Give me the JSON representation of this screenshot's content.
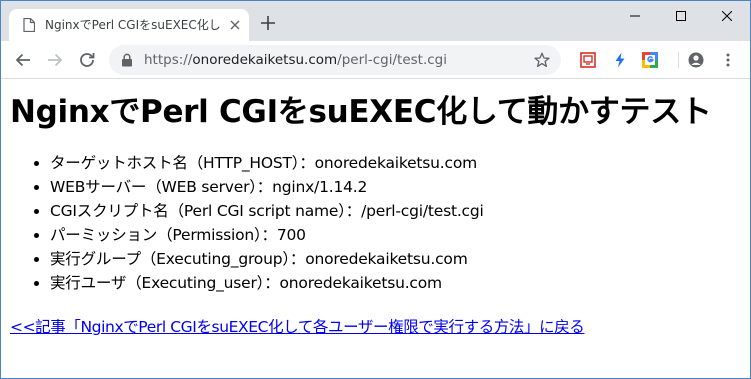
{
  "browser": {
    "tab_title": "NginxでPerl CGIをsuEXEC化して動かすテスト",
    "url_scheme": "https://",
    "url_host": "onoredekaiketsu.com",
    "url_path": "/perl-cgi/test.cgi"
  },
  "page": {
    "heading": "NginxでPerl CGIをsuEXEC化して動かすテスト",
    "items": [
      "ターゲットホスト名（HTTP_HOST）：onoredekaiketsu.com",
      "WEBサーバー（WEB server）：nginx/1.14.2",
      "CGIスクリプト名（Perl CGI script name）：/perl-cgi/test.cgi",
      "パーミッション（Permission）：700",
      "実行グループ（Executing_group）：onoredekaiketsu.com",
      "実行ユーザ（Executing_user）：onoredekaiketsu.com"
    ],
    "back_link": "<<記事「NginxでPerl CGIをsuEXEC化して各ユーザー権限で実行する方法」に戻る"
  },
  "colors": {
    "link": "#0000ee",
    "tabstrip": "#dee1e6",
    "omnibox": "#f1f3f4",
    "window_border": "#4a87c2"
  },
  "icons": [
    "page-icon",
    "close-icon",
    "new-tab-icon",
    "minimize-icon",
    "maximize-icon",
    "window-close-icon",
    "back-icon",
    "forward-icon",
    "reload-icon",
    "lock-icon",
    "star-icon",
    "extension-shield-icon",
    "extension-bolt-icon",
    "extension-google-icon",
    "profile-icon",
    "menu-icon"
  ]
}
